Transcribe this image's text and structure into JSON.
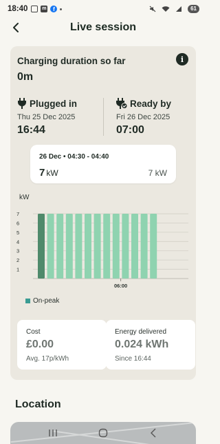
{
  "status_bar": {
    "time": "18:40",
    "battery": "61"
  },
  "header": {
    "title": "Live session"
  },
  "duration": {
    "label": "Charging duration so far",
    "value": "0m"
  },
  "plugged_in": {
    "label": "Plugged in",
    "date": "Thu 25 Dec 2025",
    "time": "16:44"
  },
  "ready_by": {
    "label": "Ready by",
    "date": "Fri 26 Dec 2025",
    "time": "07:00"
  },
  "slot": {
    "time_range": "26 Dec • 04:30 - 04:40",
    "power": "7",
    "unit": "kW",
    "right_value": "7 kW"
  },
  "chart_data": {
    "type": "bar",
    "ylabel": "kW",
    "y_ticks": [
      "1",
      "2",
      "3",
      "4",
      "5",
      "6",
      "7"
    ],
    "ylim": [
      0,
      7.6
    ],
    "x_tick_label": "06:00",
    "x_tick_index": 8,
    "selected_index": 0,
    "values": [
      7,
      7,
      7,
      7,
      7,
      7,
      7,
      7,
      7,
      7,
      7,
      7,
      7
    ],
    "legend": [
      {
        "name": "On-peak",
        "color": "#3a9c93"
      }
    ],
    "colors": {
      "bar": "#8fd3b0",
      "bar_selected": "#4f8a6b",
      "grid": "#d2cfc6"
    }
  },
  "legend": {
    "label": "On-peak"
  },
  "cost": {
    "label": "Cost",
    "value": "£0.00",
    "sub": "Avg. 17p/kWh"
  },
  "energy": {
    "label": "Energy delivered",
    "value": "0.024 kWh",
    "sub": "Since 16:44"
  },
  "location": {
    "title": "Location"
  }
}
